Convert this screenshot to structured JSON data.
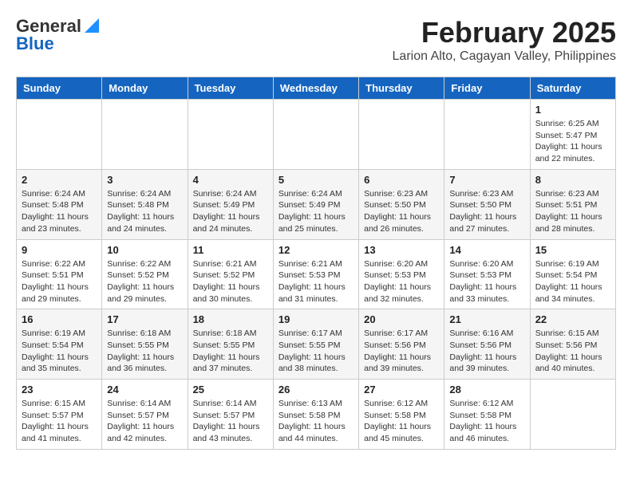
{
  "header": {
    "logo_line1": "General",
    "logo_line2": "Blue",
    "title": "February 2025",
    "subtitle": "Larion Alto, Cagayan Valley, Philippines"
  },
  "days_of_week": [
    "Sunday",
    "Monday",
    "Tuesday",
    "Wednesday",
    "Thursday",
    "Friday",
    "Saturday"
  ],
  "weeks": [
    [
      {
        "day": "",
        "info": ""
      },
      {
        "day": "",
        "info": ""
      },
      {
        "day": "",
        "info": ""
      },
      {
        "day": "",
        "info": ""
      },
      {
        "day": "",
        "info": ""
      },
      {
        "day": "",
        "info": ""
      },
      {
        "day": "1",
        "info": "Sunrise: 6:25 AM\nSunset: 5:47 PM\nDaylight: 11 hours and 22 minutes."
      }
    ],
    [
      {
        "day": "2",
        "info": "Sunrise: 6:24 AM\nSunset: 5:48 PM\nDaylight: 11 hours and 23 minutes."
      },
      {
        "day": "3",
        "info": "Sunrise: 6:24 AM\nSunset: 5:48 PM\nDaylight: 11 hours and 24 minutes."
      },
      {
        "day": "4",
        "info": "Sunrise: 6:24 AM\nSunset: 5:49 PM\nDaylight: 11 hours and 24 minutes."
      },
      {
        "day": "5",
        "info": "Sunrise: 6:24 AM\nSunset: 5:49 PM\nDaylight: 11 hours and 25 minutes."
      },
      {
        "day": "6",
        "info": "Sunrise: 6:23 AM\nSunset: 5:50 PM\nDaylight: 11 hours and 26 minutes."
      },
      {
        "day": "7",
        "info": "Sunrise: 6:23 AM\nSunset: 5:50 PM\nDaylight: 11 hours and 27 minutes."
      },
      {
        "day": "8",
        "info": "Sunrise: 6:23 AM\nSunset: 5:51 PM\nDaylight: 11 hours and 28 minutes."
      }
    ],
    [
      {
        "day": "9",
        "info": "Sunrise: 6:22 AM\nSunset: 5:51 PM\nDaylight: 11 hours and 29 minutes."
      },
      {
        "day": "10",
        "info": "Sunrise: 6:22 AM\nSunset: 5:52 PM\nDaylight: 11 hours and 29 minutes."
      },
      {
        "day": "11",
        "info": "Sunrise: 6:21 AM\nSunset: 5:52 PM\nDaylight: 11 hours and 30 minutes."
      },
      {
        "day": "12",
        "info": "Sunrise: 6:21 AM\nSunset: 5:53 PM\nDaylight: 11 hours and 31 minutes."
      },
      {
        "day": "13",
        "info": "Sunrise: 6:20 AM\nSunset: 5:53 PM\nDaylight: 11 hours and 32 minutes."
      },
      {
        "day": "14",
        "info": "Sunrise: 6:20 AM\nSunset: 5:53 PM\nDaylight: 11 hours and 33 minutes."
      },
      {
        "day": "15",
        "info": "Sunrise: 6:19 AM\nSunset: 5:54 PM\nDaylight: 11 hours and 34 minutes."
      }
    ],
    [
      {
        "day": "16",
        "info": "Sunrise: 6:19 AM\nSunset: 5:54 PM\nDaylight: 11 hours and 35 minutes."
      },
      {
        "day": "17",
        "info": "Sunrise: 6:18 AM\nSunset: 5:55 PM\nDaylight: 11 hours and 36 minutes."
      },
      {
        "day": "18",
        "info": "Sunrise: 6:18 AM\nSunset: 5:55 PM\nDaylight: 11 hours and 37 minutes."
      },
      {
        "day": "19",
        "info": "Sunrise: 6:17 AM\nSunset: 5:55 PM\nDaylight: 11 hours and 38 minutes."
      },
      {
        "day": "20",
        "info": "Sunrise: 6:17 AM\nSunset: 5:56 PM\nDaylight: 11 hours and 39 minutes."
      },
      {
        "day": "21",
        "info": "Sunrise: 6:16 AM\nSunset: 5:56 PM\nDaylight: 11 hours and 39 minutes."
      },
      {
        "day": "22",
        "info": "Sunrise: 6:15 AM\nSunset: 5:56 PM\nDaylight: 11 hours and 40 minutes."
      }
    ],
    [
      {
        "day": "23",
        "info": "Sunrise: 6:15 AM\nSunset: 5:57 PM\nDaylight: 11 hours and 41 minutes."
      },
      {
        "day": "24",
        "info": "Sunrise: 6:14 AM\nSunset: 5:57 PM\nDaylight: 11 hours and 42 minutes."
      },
      {
        "day": "25",
        "info": "Sunrise: 6:14 AM\nSunset: 5:57 PM\nDaylight: 11 hours and 43 minutes."
      },
      {
        "day": "26",
        "info": "Sunrise: 6:13 AM\nSunset: 5:58 PM\nDaylight: 11 hours and 44 minutes."
      },
      {
        "day": "27",
        "info": "Sunrise: 6:12 AM\nSunset: 5:58 PM\nDaylight: 11 hours and 45 minutes."
      },
      {
        "day": "28",
        "info": "Sunrise: 6:12 AM\nSunset: 5:58 PM\nDaylight: 11 hours and 46 minutes."
      },
      {
        "day": "",
        "info": ""
      }
    ]
  ]
}
